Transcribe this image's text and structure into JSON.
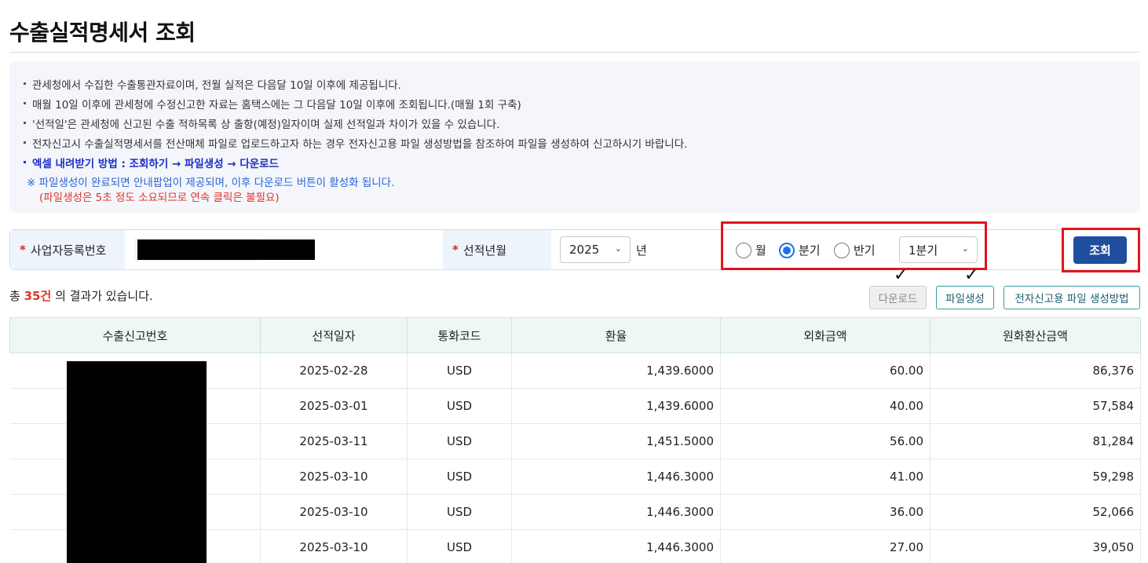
{
  "page": {
    "title": "수출실적명세서 조회"
  },
  "notice": {
    "lines": [
      "관세청에서 수집한 수출통관자료이며, 전월 실적은 다음달 10일 이후에 제공됩니다.",
      "매월 10일 이후에 관세청에 수정신고한 자료는 홈택스에는 그 다음달 10일 이후에 조회됩니다.(매월 1회 구축)",
      "'선적일'은 관세청에 신고된 수출 적하목록 상 출항(예정)일자이며 실제 선적일과 차이가 있을 수 있습니다.",
      "전자신고시 수출실적명세서를 전산매체 파일로 업로드하고자 하는 경우 전자신고용 파일 생성방법을 참조하여 파일을 생성하여 신고하시기 바랍니다."
    ],
    "excel_howto": "엑셀 내려받기 방법 :  조회하기 →  파일생성 → 다운로드",
    "note": "※ 파일생성이 완료되면 안내팝업이 제공되며, 이후  다운로드 버튼이 활성화 됩니다.",
    "note_red": "(파일생성은 5초 정도 소요되므로 연속 클릭은 불필요)"
  },
  "search": {
    "biz_no_label": "사업자등록번호",
    "ship_month_label": "선적년월",
    "year": "2025",
    "year_unit": "년",
    "period_options": [
      "월",
      "분기",
      "반기"
    ],
    "period_selected": "분기",
    "quarter": "1분기",
    "search_button": "조회"
  },
  "result": {
    "prefix": "총",
    "count": "35건",
    "suffix": "의 결과가 있습니다."
  },
  "toolbar": {
    "download": "다운로드",
    "create_file": "파일생성",
    "howto": "전자신고용 파일 생성방법"
  },
  "table": {
    "headers": [
      "수출신고번호",
      "선적일자",
      "통화코드",
      "환율",
      "외화금액",
      "원화환산금액"
    ],
    "rows": [
      {
        "date": "2025-02-28",
        "currency": "USD",
        "rate": "1,439.6000",
        "foreign": "60.00",
        "krw": "86,376"
      },
      {
        "date": "2025-03-01",
        "currency": "USD",
        "rate": "1,439.6000",
        "foreign": "40.00",
        "krw": "57,584"
      },
      {
        "date": "2025-03-11",
        "currency": "USD",
        "rate": "1,451.5000",
        "foreign": "56.00",
        "krw": "81,284"
      },
      {
        "date": "2025-03-10",
        "currency": "USD",
        "rate": "1,446.3000",
        "foreign": "41.00",
        "krw": "59,298"
      },
      {
        "date": "2025-03-10",
        "currency": "USD",
        "rate": "1,446.3000",
        "foreign": "36.00",
        "krw": "52,066"
      },
      {
        "date": "2025-03-10",
        "currency": "USD",
        "rate": "1,446.3000",
        "foreign": "27.00",
        "krw": "39,050"
      }
    ]
  },
  "colors": {
    "accent_blue": "#1f4e9e",
    "highlight_red": "#e3141b",
    "count_red": "#e0332b",
    "teal_border": "#3f9b9b"
  }
}
